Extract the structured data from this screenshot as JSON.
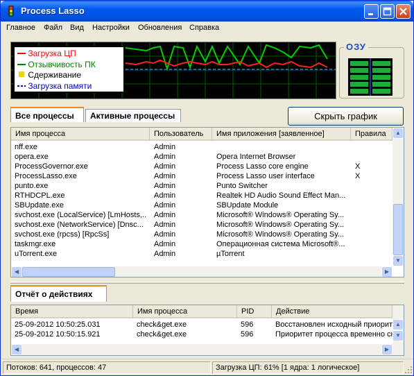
{
  "window": {
    "title": "Process Lasso"
  },
  "menu": [
    "Главное",
    "Файл",
    "Вид",
    "Настройки",
    "Обновления",
    "Справка"
  ],
  "legend": [
    {
      "label": "Загрузка ЦП",
      "color": "#ff0000"
    },
    {
      "label": "Отзывчивость ПК",
      "color": "#008000"
    },
    {
      "label": "Сдерживание",
      "color": "#000000"
    },
    {
      "label": "Загрузка памяти",
      "color": "#0000cc"
    }
  ],
  "memory": {
    "label": "ОЗУ"
  },
  "tabs_top": [
    "Все процессы",
    "Активные процессы"
  ],
  "hide_graph_button": "Скрыть график",
  "process_table": {
    "columns": [
      "Имя процесса",
      "Пользователь",
      "Имя приложения [заявленное]",
      "Правила"
    ],
    "rows": [
      [
        "nff.exe",
        "Admin",
        "",
        ""
      ],
      [
        "opera.exe",
        "Admin",
        "Opera Internet Browser",
        ""
      ],
      [
        "ProcessGovernor.exe",
        "Admin",
        "Process Lasso core engine",
        "X"
      ],
      [
        "ProcessLasso.exe",
        "Admin",
        "Process Lasso user interface",
        "X"
      ],
      [
        "punto.exe",
        "Admin",
        "Punto Switcher",
        ""
      ],
      [
        "RTHDCPL.exe",
        "Admin",
        "Realtek HD Audio Sound Effect Man...",
        ""
      ],
      [
        "SBUpdate.exe",
        "Admin",
        "SBUpdate Module",
        ""
      ],
      [
        "svchost.exe (LocalService) [LmHosts,...",
        "Admin",
        "Microsoft® Windows® Operating Sy...",
        ""
      ],
      [
        "svchost.exe (NetworkService) [Dnsc...",
        "Admin",
        "Microsoft® Windows® Operating Sy...",
        ""
      ],
      [
        "svchost.exe (rpcss) [RpcSs]",
        "Admin",
        "Microsoft® Windows® Operating Sy...",
        ""
      ],
      [
        "taskmgr.exe",
        "Admin",
        "Операционная система Microsoft®...",
        ""
      ],
      [
        "uTorrent.exe",
        "Admin",
        "µTorrent",
        ""
      ]
    ]
  },
  "actions_tab": "Отчёт о действиях",
  "actions_table": {
    "columns": [
      "Время",
      "Имя процесса",
      "PID",
      "Действие"
    ],
    "rows": [
      [
        "25-09-2012 10:50:25.031",
        "check&get.exe",
        "596",
        "Восстановлен исходный приорите"
      ],
      [
        "25-09-2012 10:50:15.921",
        "check&get.exe",
        "596",
        "Приоритет процесса временно сни"
      ]
    ]
  },
  "status": {
    "left": "Потоков: 641,  процессов: 47",
    "right": "Загрузка ЦП: 61% [1 ядра: 1 логическое]"
  }
}
